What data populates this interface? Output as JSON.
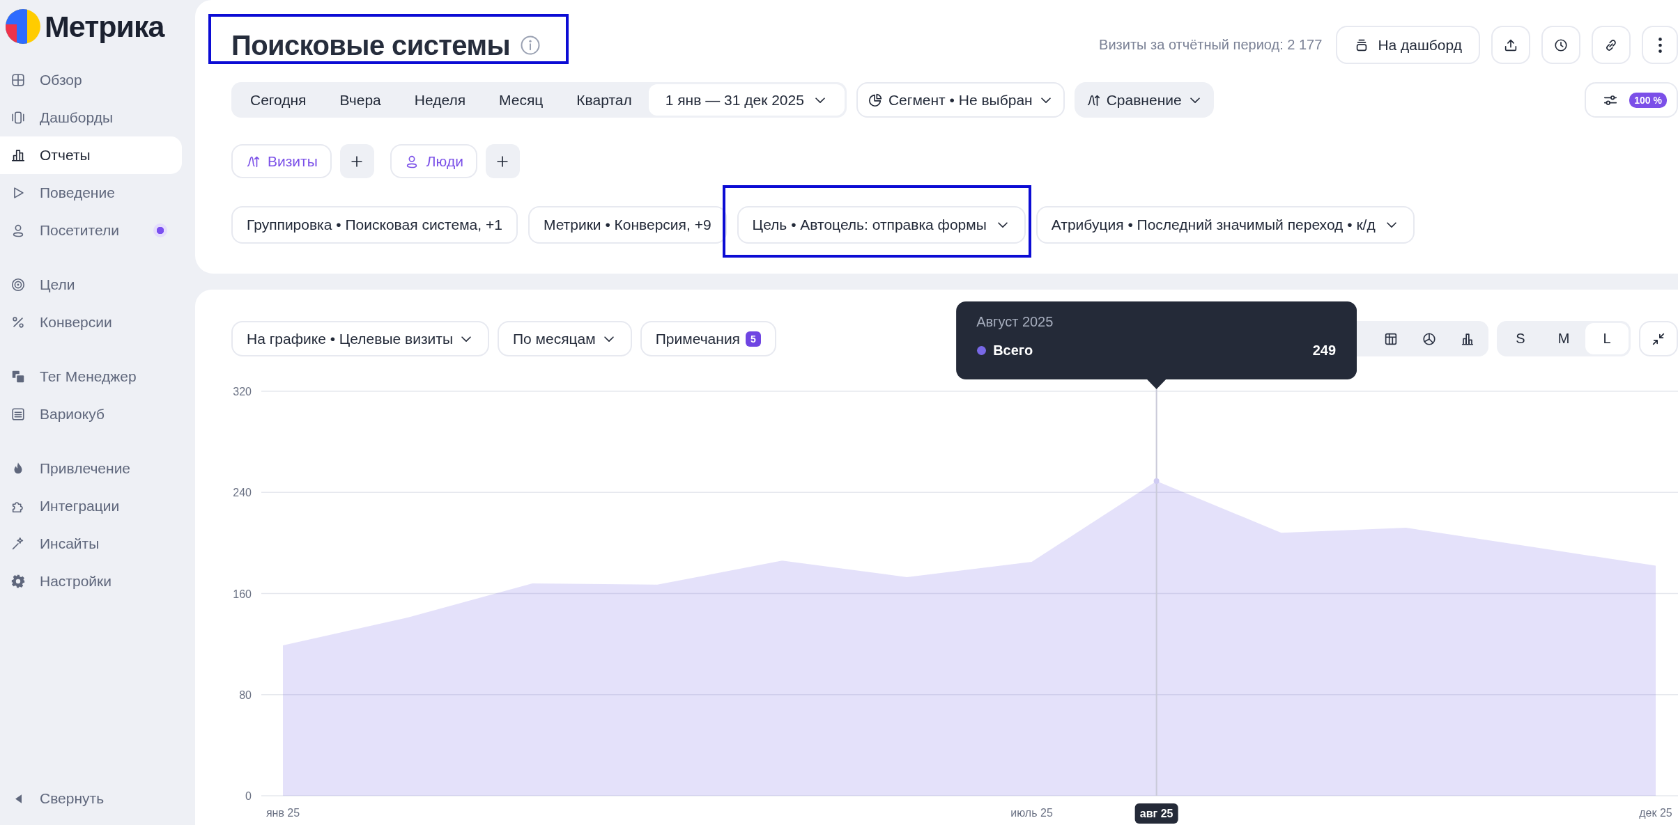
{
  "sidebar": {
    "logo": "Метрика",
    "sections": [
      {
        "items": [
          {
            "label": "Обзор",
            "selected": false,
            "indicator": false
          },
          {
            "label": "Дашборды",
            "selected": false,
            "indicator": false
          },
          {
            "label": "Отчеты",
            "selected": true,
            "indicator": false
          },
          {
            "label": "Поведение",
            "selected": false,
            "indicator": false
          },
          {
            "label": "Посетители",
            "selected": false,
            "indicator": true
          }
        ]
      },
      {
        "items": [
          {
            "label": "Цели",
            "selected": false,
            "indicator": false
          },
          {
            "label": "Конверсии",
            "selected": false,
            "indicator": false
          }
        ]
      },
      {
        "items": [
          {
            "label": "Тег Менеджер",
            "selected": false,
            "indicator": false
          },
          {
            "label": "Вариокуб",
            "selected": false,
            "indicator": false
          }
        ]
      },
      {
        "items": [
          {
            "label": "Привлечение",
            "selected": false,
            "indicator": false
          },
          {
            "label": "Интеграции",
            "selected": false,
            "indicator": false
          },
          {
            "label": "Инсайты",
            "selected": false,
            "indicator": false
          },
          {
            "label": "Настройки",
            "selected": false,
            "indicator": false
          }
        ]
      }
    ],
    "collapse": "Свернуть"
  },
  "header": {
    "title": "Поисковые системы",
    "highlighted": true,
    "total": "Визиты за отчётный период: 2 177",
    "dashboard_button": "На дашборд"
  },
  "period_bar": {
    "periods": [
      {
        "label": "Сегодня",
        "kind": "preset",
        "selected": false
      },
      {
        "label": "Вчера",
        "kind": "preset",
        "selected": false
      },
      {
        "label": "Неделя",
        "kind": "preset",
        "selected": false
      },
      {
        "label": "Месяц",
        "kind": "preset",
        "selected": false
      },
      {
        "label": "Квартал",
        "kind": "preset",
        "selected": false
      },
      {
        "label": "1 янв — 31 дек 2025",
        "kind": "range",
        "selected": true
      }
    ],
    "segment": "Сегмент • Не выбран",
    "comparison": "Сравнение",
    "settings_badge": "100 %"
  },
  "metrics": [
    {
      "label": "Визиты"
    },
    {
      "label": "Люди"
    }
  ],
  "filters": [
    {
      "label": "Группировка • Поисковая система, +1",
      "dropdown": false,
      "highlighted": false
    },
    {
      "label": "Метрики • Конверсия, +9",
      "dropdown": false,
      "highlighted": false
    },
    {
      "label": "Цель • Автоцель: отправка формы",
      "dropdown": true,
      "highlighted": true
    },
    {
      "label": "Атрибуция • Последний значимый переход • к/д",
      "dropdown": true,
      "highlighted": false
    }
  ],
  "chart": {
    "series_select": "На графике • Целевые визиты",
    "grouping": "По месяцам",
    "notes": {
      "label": "Примечания",
      "count": "5"
    },
    "sizes": [
      {
        "label": "S",
        "selected": false
      },
      {
        "label": "M",
        "selected": false
      },
      {
        "label": "L",
        "selected": true
      }
    ],
    "tooltip": {
      "title": "Август 2025",
      "values": [
        "249"
      ]
    },
    "chart_data": {
      "type": "area",
      "categories": [
        "янв 25",
        null,
        null,
        null,
        null,
        null,
        "июль 25",
        "авг 25",
        null,
        null,
        null,
        "дек 25"
      ],
      "series": [
        {
          "name": "Всего",
          "color": "#7868e6",
          "values": [
            119,
            141,
            168,
            167,
            186,
            173,
            185,
            249,
            208,
            212,
            197,
            182
          ]
        }
      ],
      "ylim": [
        0,
        320
      ],
      "yticks": [
        0,
        80,
        160,
        240,
        320
      ],
      "grid": true,
      "annotations": [
        {
          "x": "авг 25"
        }
      ]
    }
  }
}
